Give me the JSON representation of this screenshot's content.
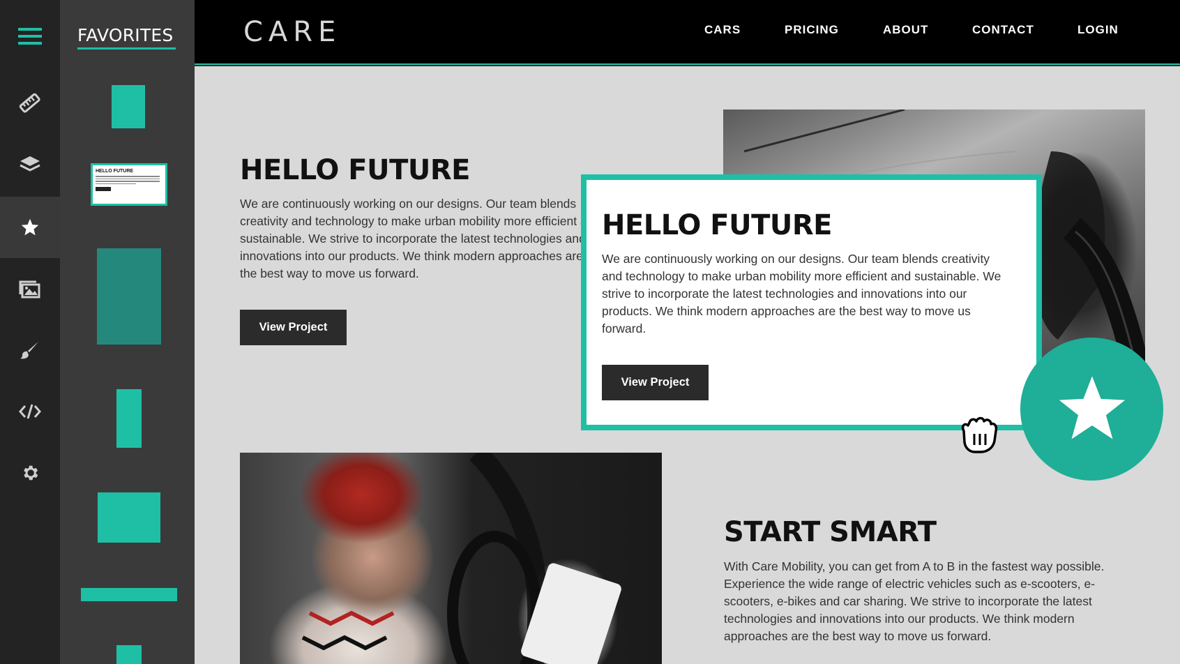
{
  "rail": {
    "items": [
      {
        "icon": "hamburger-menu-icon"
      },
      {
        "icon": "ruler-icon"
      },
      {
        "icon": "layers-icon"
      },
      {
        "icon": "star-icon",
        "active": true
      },
      {
        "icon": "image-gallery-icon"
      },
      {
        "icon": "paint-brush-icon"
      },
      {
        "icon": "code-icon"
      },
      {
        "icon": "gear-icon"
      }
    ]
  },
  "favorites": {
    "title": "FAVORITES",
    "thumb_title": "HELLO FUTURE"
  },
  "header": {
    "logo": "CARE",
    "nav": [
      "CARS",
      "PRICING",
      "ABOUT",
      "CONTACT",
      "LOGIN"
    ]
  },
  "section1": {
    "title": "HELLO FUTURE",
    "text": "We are continuously working on our designs. Our team blends creativity and technology to make urban mobility more efficient and sustainable. We strive to incorporate the latest technologies and innovations into our products. We think modern approaches are the best way to move us forward.",
    "button": "View Project"
  },
  "drag_card": {
    "title": "HELLO FUTURE",
    "text": "We are continuously working on our designs. Our team blends creativity and technology to make urban mobility more efficient and sustainable. We strive to incorporate the latest technologies and innovations into our products. We think modern approaches are the best way to move us forward.",
    "button": "View Project"
  },
  "section2": {
    "title": "START SMART",
    "text": "With Care Mobility, you can get from A to B in the fastest way possible. Experience the wide range of electric vehicles such as e-scooters, e-scooters, e-bikes and car sharing. We strive to incorporate the latest technologies and innovations into our products. We think modern approaches are the best way to move us forward."
  },
  "colors": {
    "accent": "#1fbfa6",
    "accent_dark": "#24897c",
    "rail_bg": "#232323",
    "panel_bg": "#3a3a3a",
    "topbar_bg": "#000000",
    "canvas_bg": "#d9d9d9",
    "button_bg": "#2b2b2b"
  }
}
